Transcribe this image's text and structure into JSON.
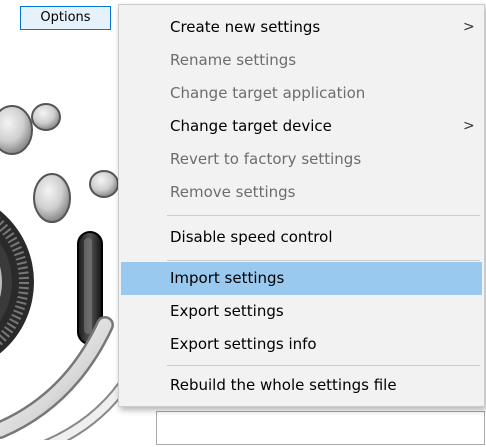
{
  "toolbar": {
    "options_label": "Options"
  },
  "menu": {
    "items": [
      {
        "label": "Create new settings",
        "submenu_arrow": ">",
        "enabled": true
      },
      {
        "label": "Rename settings",
        "enabled": false
      },
      {
        "label": "Change target application",
        "enabled": false
      },
      {
        "label": "Change target device",
        "submenu_arrow": ">",
        "enabled": true
      },
      {
        "label": "Revert to factory settings",
        "enabled": false
      },
      {
        "label": "Remove settings",
        "enabled": false
      },
      {
        "label": "Disable speed control",
        "enabled": true
      },
      {
        "label": "Import settings",
        "enabled": true,
        "highlighted": true
      },
      {
        "label": "Export settings",
        "enabled": true
      },
      {
        "label": "Export settings info",
        "enabled": true
      },
      {
        "label": "Rebuild the whole settings file",
        "enabled": true
      }
    ]
  },
  "colors": {
    "menu_background": "#f2f2f2",
    "highlight": "#99c9ef",
    "disabled_text": "#6d6d6d",
    "button_border": "#0078d7"
  }
}
